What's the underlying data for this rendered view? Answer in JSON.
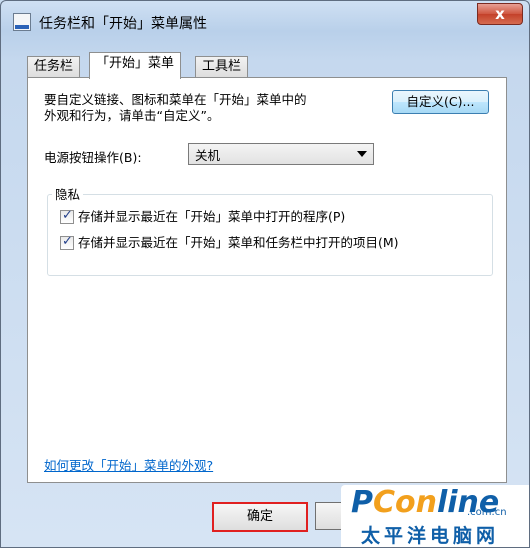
{
  "window": {
    "title": "任务栏和「开始」菜单属性",
    "close_symbol": "x"
  },
  "tabs": [
    {
      "label": "任务栏",
      "selected": false
    },
    {
      "label": "「开始」菜单",
      "selected": true
    },
    {
      "label": "工具栏",
      "selected": false
    }
  ],
  "start_menu": {
    "intro_line1": "要自定义链接、图标和菜单在「开始」菜单中的",
    "intro_line2": "外观和行为，请单击“自定义”。",
    "customize_label": "自定义(C)...",
    "power_label": "电源按钮操作(B):",
    "power_value": "关机",
    "privacy": {
      "title": "隐私",
      "items": [
        {
          "label": "存储并显示最近在「开始」菜单中打开的程序(P)",
          "checked": true,
          "mark": "✓"
        },
        {
          "label": "存储并显示最近在「开始」菜单和任务栏中打开的项目(M)",
          "checked": true,
          "mark": "✓"
        }
      ]
    },
    "help_link": "如何更改「开始」菜单的外观?"
  },
  "footer": {
    "ok_label": "确定"
  },
  "watermark": {
    "brand_p": "P",
    "brand_con": "Con",
    "brand_line": "line",
    "domain": ".com.cn",
    "chinese": "太平洋电脑网"
  }
}
